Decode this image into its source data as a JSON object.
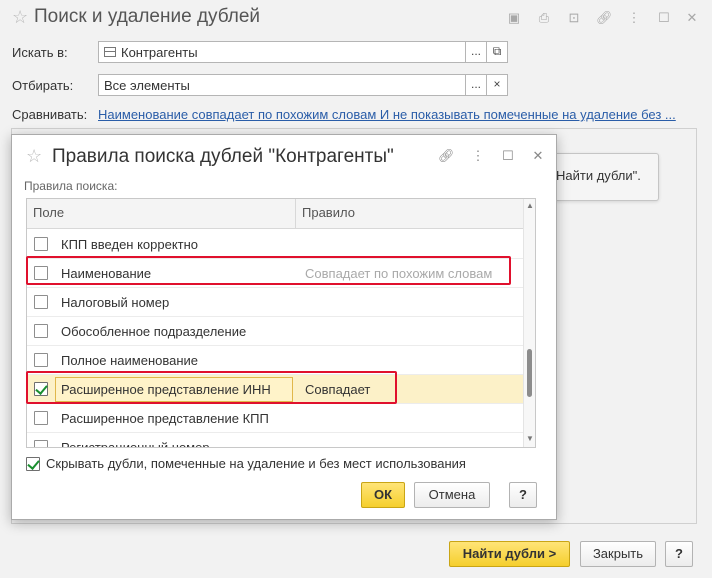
{
  "main": {
    "title": "Поиск и удаление дублей",
    "search_in": {
      "label": "Искать в:",
      "value": "Контрагенты",
      "btn_more": "...",
      "btn_open": "⧉"
    },
    "filter": {
      "label": "Отбирать:",
      "value": "Все элементы",
      "btn_more": "...",
      "btn_clear": "×"
    },
    "compare": {
      "label": "Сравнивать:",
      "value": "Наименование совпадает по похожим словам И не показывать помеченные на удаление без ..."
    },
    "bg_find_button": "Найти дубли\".",
    "find_button": "Найти дубли >",
    "close_button": "Закрыть",
    "help_button": "?"
  },
  "dialog": {
    "title": "Правила поиска дублей \"Контрагенты\"",
    "rules_label": "Правила поиска:",
    "columns": {
      "field": "Поле",
      "rule": "Правило"
    },
    "rows": [
      {
        "field": "КПП введен корректно",
        "rule": "",
        "checked": false
      },
      {
        "field": "Наименование",
        "rule": "Совпадает по похожим словам",
        "checked": false
      },
      {
        "field": "Налоговый номер",
        "rule": "",
        "checked": false
      },
      {
        "field": "Обособленное подразделение",
        "rule": "",
        "checked": false
      },
      {
        "field": "Полное наименование",
        "rule": "",
        "checked": false
      },
      {
        "field": "Расширенное представление ИНН",
        "rule": "Совпадает",
        "checked": true
      },
      {
        "field": "Расширенное представление КПП",
        "rule": "",
        "checked": false
      },
      {
        "field": "Регистрационный номер",
        "rule": "",
        "checked": false
      }
    ],
    "hide_duplicates_label": "Скрывать дубли, помеченные на удаление и без мест использования",
    "hide_duplicates_checked": true,
    "ok_button": "ОК",
    "cancel_button": "Отмена",
    "help_button": "?"
  },
  "colors": {
    "accent_yellow": "#f5cf2d",
    "highlight_red": "#e0102d",
    "check_green": "#1a8f2f",
    "link_blue": "#2a5da8"
  }
}
